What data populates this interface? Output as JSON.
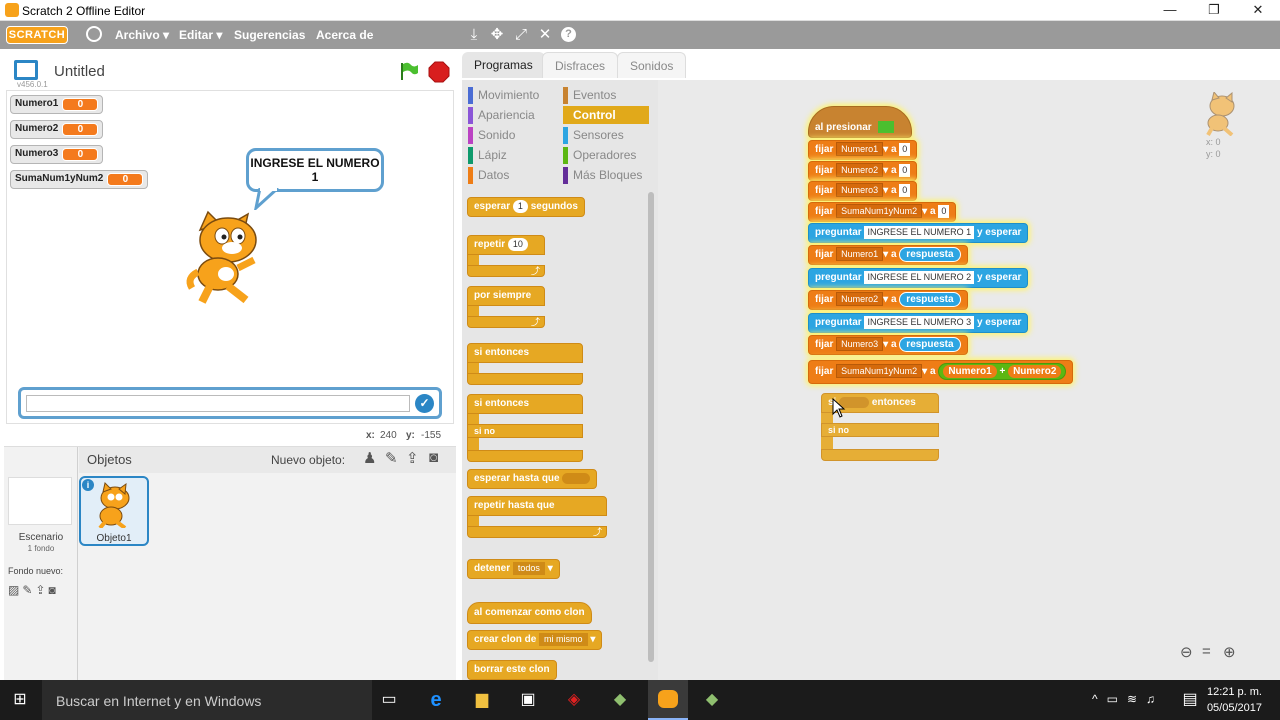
{
  "window": {
    "title": "Scratch 2 Offline Editor",
    "controls": [
      "—",
      "❐",
      "✕"
    ]
  },
  "menubar": {
    "logo": "SCRATCH",
    "items": [
      "Archivo ▾",
      "Editar ▾",
      "Sugerencias",
      "Acerca de"
    ],
    "tools": [
      "stamp-icon",
      "grow-icon",
      "expand-icon",
      "shrink-icon",
      "help-icon"
    ]
  },
  "stage": {
    "project_name": "Untitled",
    "version": "v456.0.1",
    "variables": [
      {
        "name": "Numero1",
        "value": "0"
      },
      {
        "name": "Numero2",
        "value": "0"
      },
      {
        "name": "Numero3",
        "value": "0"
      },
      {
        "name": "SumaNum1yNum2",
        "value": "0"
      }
    ],
    "speech": "INGRESE EL NUMERO 1",
    "answer_placeholder": "",
    "coords": {
      "x_label": "x:",
      "x_value": "240",
      "y_label": "y:",
      "y_value": "-155"
    }
  },
  "sprites": {
    "header": "Objetos",
    "new_object": "Nuevo objeto:",
    "stage_label": "Escenario",
    "stage_sub": "1 fondo",
    "new_backdrop": "Fondo nuevo:",
    "sprite_name": "Objeto1"
  },
  "tabs": [
    "Programas",
    "Disfraces",
    "Sonidos"
  ],
  "categories": {
    "left": [
      {
        "label": "Movimiento",
        "color": "#4a6cd4"
      },
      {
        "label": "Apariencia",
        "color": "#8a55d7"
      },
      {
        "label": "Sonido",
        "color": "#bb42c3"
      },
      {
        "label": "Lápiz",
        "color": "#0e9a6c"
      },
      {
        "label": "Datos",
        "color": "#ee7d16"
      }
    ],
    "right": [
      {
        "label": "Eventos",
        "color": "#c88330"
      },
      {
        "label": "Control",
        "color": "#e1a91a"
      },
      {
        "label": "Sensores",
        "color": "#2ca5e2"
      },
      {
        "label": "Operadores",
        "color": "#5cb712"
      },
      {
        "label": "Más Bloques",
        "color": "#632d99"
      }
    ]
  },
  "palette": {
    "wait": {
      "pre": "esperar",
      "val": "1",
      "post": "segundos"
    },
    "repeat": {
      "label": "repetir",
      "val": "10"
    },
    "forever": "por siempre",
    "if": {
      "si": "si",
      "then": "entonces"
    },
    "ifelse": {
      "si": "si",
      "then": "entonces",
      "else": "si no"
    },
    "wait_until": "esperar hasta que",
    "repeat_until": "repetir hasta que",
    "stop": {
      "label": "detener",
      "val": "todos"
    },
    "clone_start": "al comenzar como clon",
    "create_clone": {
      "label": "crear clon de",
      "val": "mi mismo"
    },
    "delete_clone": "borrar este clon"
  },
  "script": {
    "hat": "al presionar",
    "set_label": "fijar",
    "to_label": "a",
    "ask_label": "preguntar",
    "wait_label": "y esperar",
    "answer": "respuesta",
    "plus": "+",
    "rows": [
      {
        "var": "Numero1",
        "val": "0"
      },
      {
        "var": "Numero2",
        "val": "0"
      },
      {
        "var": "Numero3",
        "val": "0"
      },
      {
        "var": "SumaNum1yNum2",
        "val": "0"
      }
    ],
    "asks": [
      "INGRESE EL NUMERO 1",
      "INGRESE EL NUMERO 2",
      "INGRESE EL NUMERO 3"
    ],
    "set_answers": [
      "Numero1",
      "Numero2",
      "Numero3"
    ],
    "sum": {
      "var": "SumaNum1yNum2",
      "a": "Numero1",
      "b": "Numero2"
    },
    "dragging_if": {
      "si": "si",
      "then": "entonces",
      "else": "si no"
    },
    "sprite_xy": {
      "x": "x: 0",
      "y": "y: 0"
    }
  },
  "taskbar": {
    "search": "Buscar en Internet y en Windows",
    "time": "12:21 p. m.",
    "date": "05/05/2017"
  }
}
